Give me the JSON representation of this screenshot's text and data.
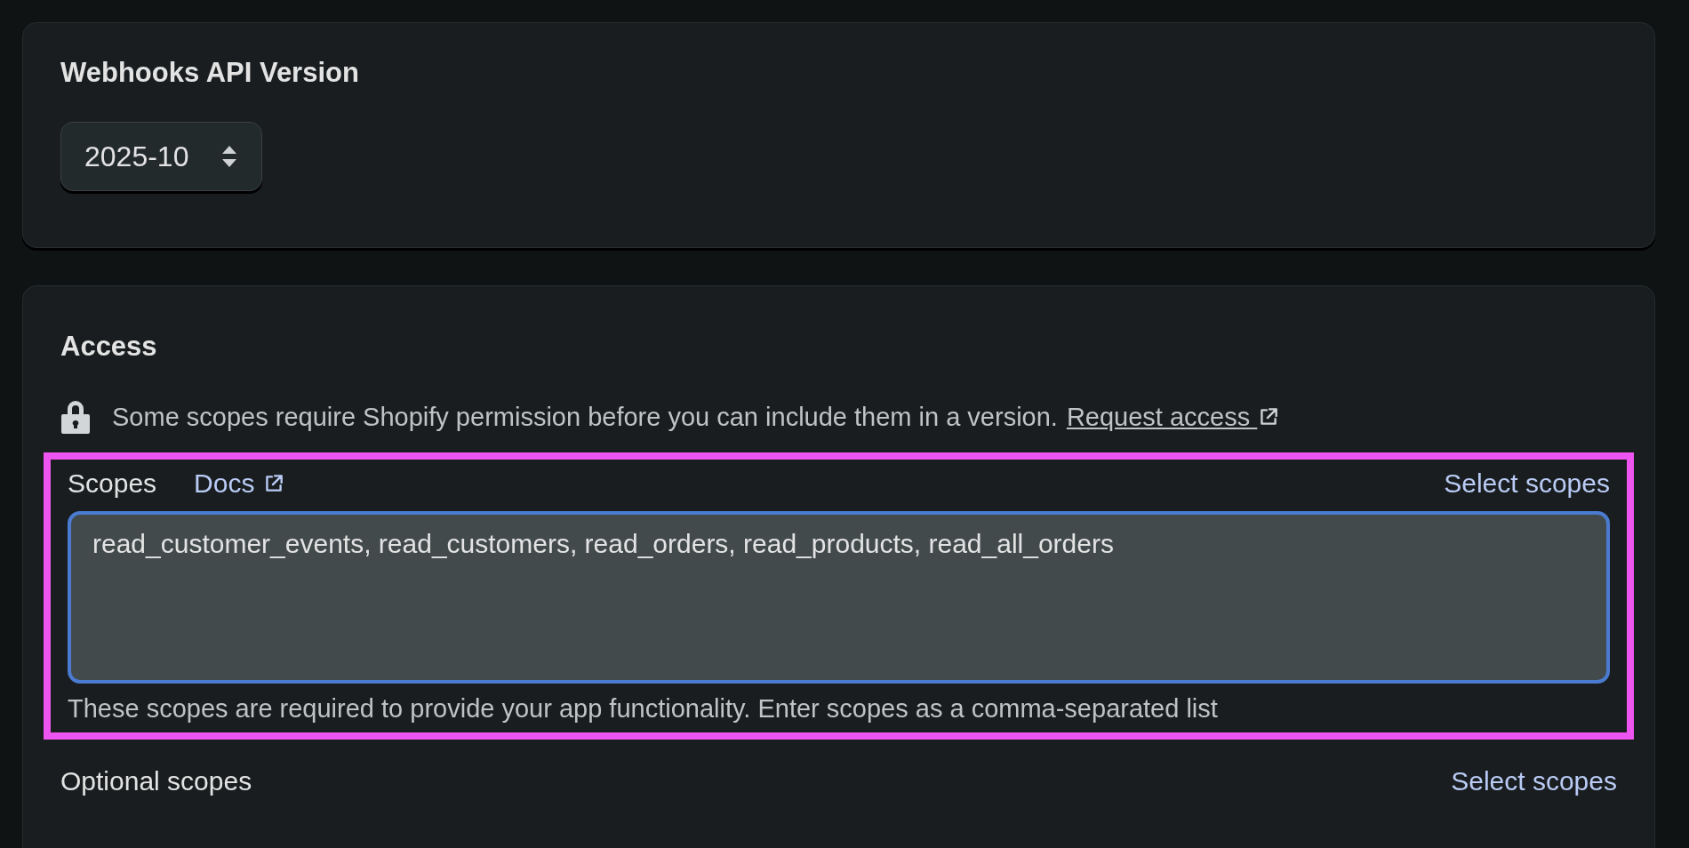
{
  "webhooks_card": {
    "title": "Webhooks API Version",
    "version_select": {
      "value": "2025-10"
    }
  },
  "access_card": {
    "title": "Access",
    "notice": {
      "text": "Some scopes require Shopify permission before you can include them in a version.",
      "link": "Request access"
    },
    "scopes": {
      "label": "Scopes",
      "docs_link": "Docs",
      "select_link": "Select scopes",
      "highlighted": true,
      "focused": true,
      "value": "read_customer_events, read_customers, read_orders, read_products, read_all_orders",
      "help": "These scopes are required to provide your app functionality. Enter scopes as a comma-separated list"
    },
    "optional_scopes": {
      "label": "Optional scopes",
      "select_link": "Select scopes"
    }
  }
}
